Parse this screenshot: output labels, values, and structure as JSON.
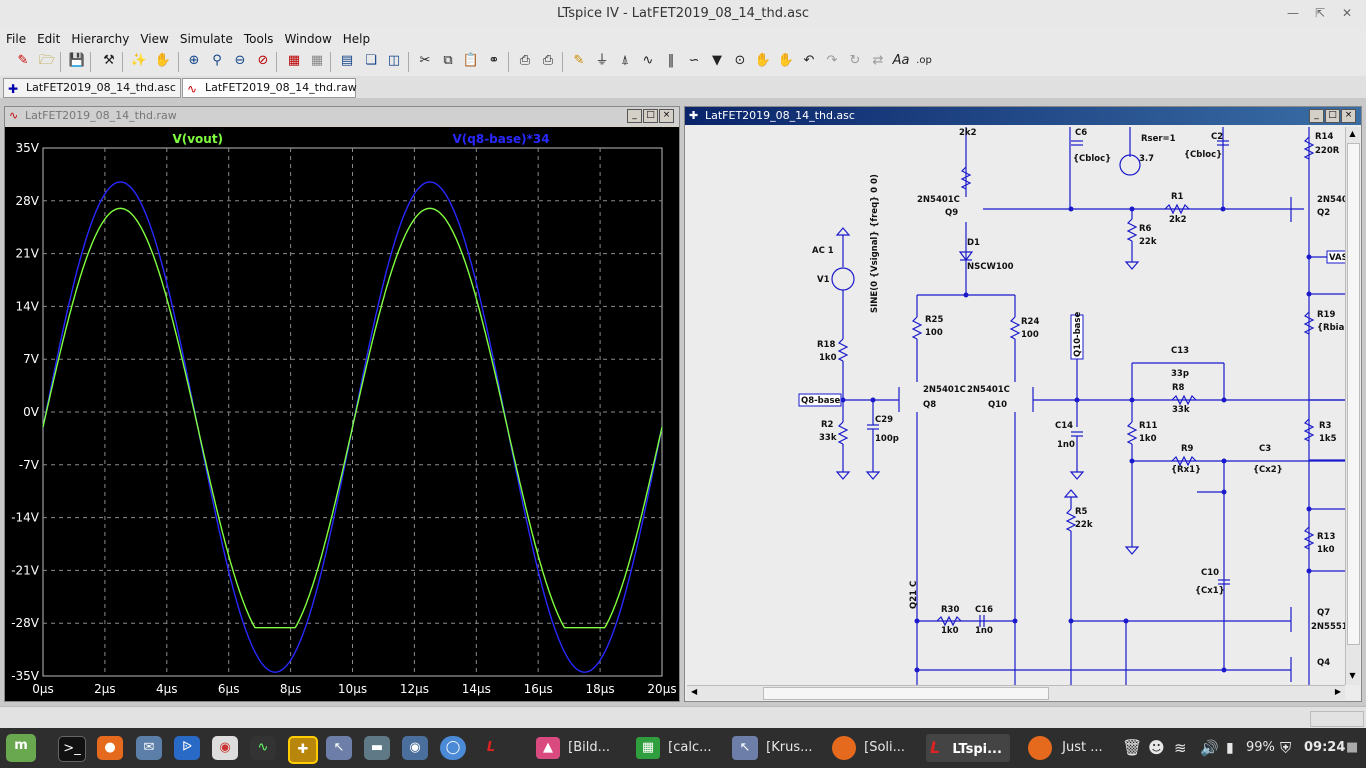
{
  "window": {
    "title": "LTspice IV - LatFET2019_08_14_thd.asc"
  },
  "menu": [
    "File",
    "Edit",
    "Hierarchy",
    "View",
    "Simulate",
    "Tools",
    "Window",
    "Help"
  ],
  "tabs": [
    {
      "label": "LatFET2019_08_14_thd.asc",
      "icon": "schematic-icon"
    },
    {
      "label": "LatFET2019_08_14_thd.raw",
      "icon": "waveform-icon"
    }
  ],
  "waveform_window": {
    "title": "LatFET2019_08_14_thd.raw",
    "trace1": "V(vout)",
    "trace2": "V(q8-base)*34",
    "colors": {
      "trace1": "#80ff40",
      "trace2": "#2828ff",
      "grid": "#8a8a8a",
      "bg": "#000000"
    }
  },
  "chart_data": {
    "type": "line",
    "xlabel": "",
    "ylabel": "",
    "x_ticks": [
      "0µs",
      "2µs",
      "4µs",
      "6µs",
      "8µs",
      "10µs",
      "12µs",
      "14µs",
      "16µs",
      "18µs",
      "20µs"
    ],
    "y_ticks": [
      "35V",
      "28V",
      "21V",
      "14V",
      "7V",
      "0V",
      "-7V",
      "-14V",
      "-21V",
      "-28V",
      "-35V"
    ],
    "xlim": [
      0,
      20
    ],
    "ylim": [
      -35,
      35
    ],
    "grid": true,
    "legend": "top",
    "series": [
      {
        "name": "V(vout)",
        "amplitude": 29.0,
        "clip": 28.6,
        "frequency_mhz": 0.1,
        "offset_v": -2.0
      },
      {
        "name": "V(q8-base)*34",
        "amplitude": 32.5,
        "frequency_mhz": 0.1,
        "offset_v": -2.0
      }
    ]
  },
  "schematic_window": {
    "title": "LatFET2019_08_14_thd.asc",
    "labels": {
      "r_2k2_top": "2k2",
      "c6": "C6",
      "cbloc1": "{Cbloc}",
      "v4_val": "3.7",
      "rser": "Rser=1",
      "c2": "C2",
      "cbloc2": "{Cbloc}",
      "r14": "R14",
      "r14v": "220R",
      "q9_model": "2N5401C",
      "q9": "Q9",
      "r1": "R1",
      "r1v": "2k2",
      "q2_model": "2N540",
      "q2": "Q2",
      "ac1": "AC 1",
      "v1": "V1",
      "sine": "SINE(0 {Vsignal} {freq} 0 0)",
      "d1": "D1",
      "d1_model": "NSCW100",
      "r6": "R6",
      "r6v": "22k",
      "vas": "VAS",
      "r25": "R25",
      "r25v": "100",
      "r24": "R24",
      "r24v": "100",
      "q10base": "Q10-base",
      "r19": "R19",
      "r19v": "{Rbia",
      "r18": "R18",
      "r18v": "1k0",
      "c13": "C13",
      "c13v": "33p",
      "r8": "R8",
      "r8v": "33k",
      "q8base": "Q8-base",
      "q8_model": "2N5401C",
      "q8": "Q8",
      "q10_model": "2N5401C",
      "q10": "Q10",
      "r2": "R2",
      "r2v": "33k",
      "c29": "C29",
      "c29v": "100p",
      "c14": "C14",
      "c14v": "1n0",
      "r11": "R11",
      "r11v": "1k0",
      "r3": "R3",
      "r3v": "1k5",
      "r9": "R9",
      "r9v": "{Rx1}",
      "c3": "C3",
      "c3v": "{Cx2}",
      "r5": "R5",
      "r5v": "22k",
      "r13": "R13",
      "r13v": "1k0",
      "c10": "C10",
      "c10v": "{Cx1}",
      "q21": "Q21 C",
      "r30": "R30",
      "r30v": "1k0",
      "c16": "C16",
      "c16v": "1n0",
      "q7": "Q7",
      "q7_model": "2N5551",
      "q4": "Q4"
    }
  },
  "taskbar": {
    "items": [
      {
        "label": "[Bild..."
      },
      {
        "label": "[calc..."
      },
      {
        "label": "[Krus..."
      },
      {
        "label": "[Soli..."
      },
      {
        "label": "LTspi..."
      },
      {
        "label": "Just ..."
      }
    ],
    "battery": "99%",
    "clock": "09:24"
  }
}
